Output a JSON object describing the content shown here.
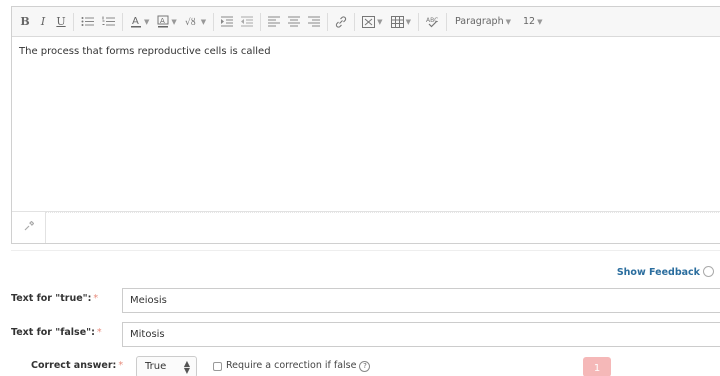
{
  "toolbar": {
    "bold": "B",
    "italic": "I",
    "underline": "U",
    "block_format": "Paragraph",
    "font_size": "12"
  },
  "editor": {
    "content": "The process that forms reproductive cells is called"
  },
  "show_feedback": "Show Feedback",
  "fields": {
    "true_label": "Text for \"true\":",
    "true_value": "Meiosis",
    "false_label": "Text for \"false\":",
    "false_value": "Mitosis",
    "required_mark": "*"
  },
  "correct_answer": {
    "label": "Correct answer:",
    "value": "True",
    "checkbox_label": "Require a correction if false",
    "help": "?"
  },
  "badge": "1"
}
